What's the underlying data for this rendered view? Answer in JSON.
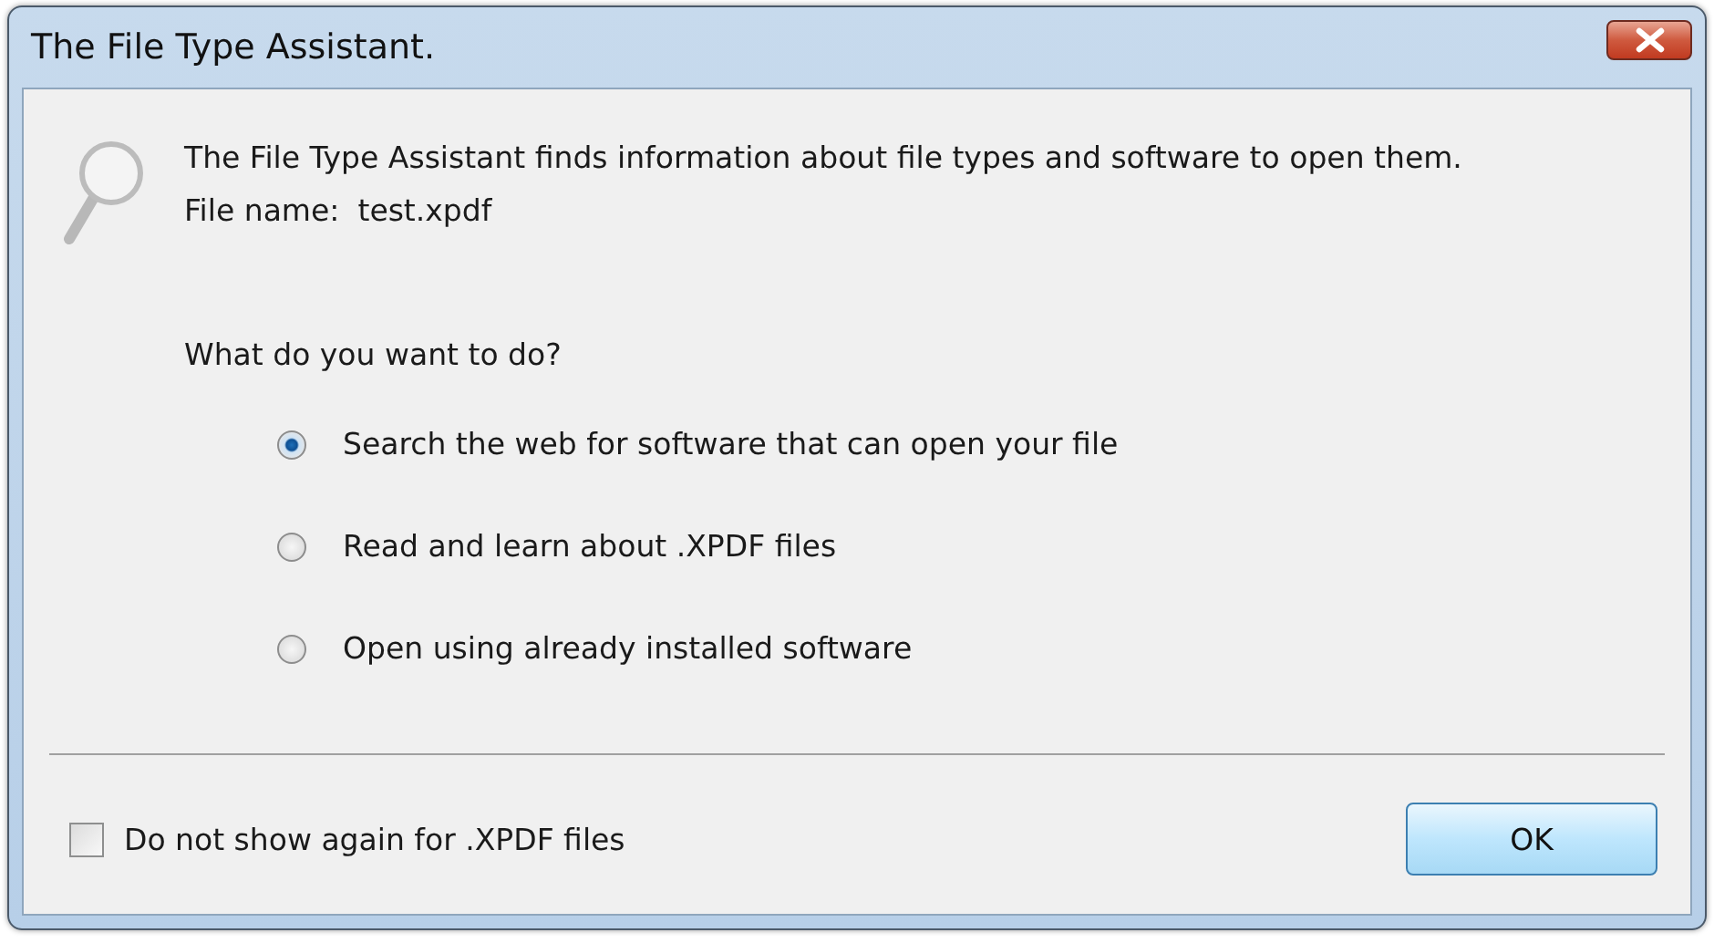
{
  "window": {
    "title": "The File Type Assistant."
  },
  "intro": "The File Type Assistant finds information about file types and software to open them.",
  "file_name": {
    "label": "File name:",
    "value": "test.xpdf"
  },
  "question": "What do you want to do?",
  "options": [
    {
      "label": "Search the web for software that can open your file",
      "selected": true
    },
    {
      "label": "Read and learn about .XPDF files",
      "selected": false
    },
    {
      "label": "Open using already installed software",
      "selected": false
    }
  ],
  "dont_show": {
    "label": "Do not show again for .XPDF files",
    "checked": false
  },
  "buttons": [
    "OK"
  ]
}
